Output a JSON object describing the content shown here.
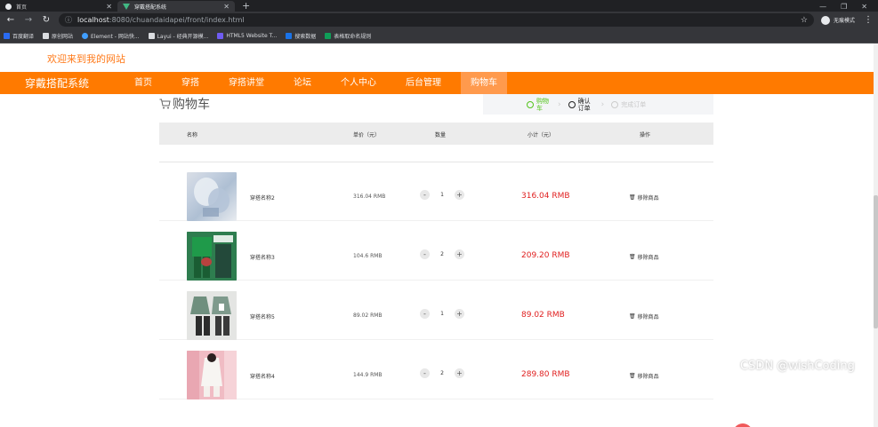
{
  "browser": {
    "tabs": [
      {
        "title": "首页",
        "icon": "globe-icon"
      },
      {
        "title": "穿戴搭配系统",
        "icon": "vue-icon"
      }
    ],
    "url_host": "localhost",
    "url_path": ":8080/chuandaidapei/front/index.html",
    "profile_label": "无痕模式",
    "bookmarks": [
      "百度翻译",
      "原创网站",
      "Element - 网站快...",
      "Layui - 经典开源模...",
      "HTML5 Website T...",
      "搜索数据",
      "表格取命名规则"
    ]
  },
  "header": {
    "welcome": "欢迎来到我的网站",
    "brand": "穿戴搭配系统",
    "nav": [
      "首页",
      "穿搭",
      "穿搭讲堂",
      "论坛",
      "个人中心",
      "后台管理",
      "购物车"
    ],
    "active_nav": "购物车"
  },
  "cart": {
    "title": "购物车",
    "steps": [
      {
        "label": "购物车",
        "state": "done"
      },
      {
        "label": "确认订单",
        "state": "current"
      },
      {
        "label": "完成订单",
        "state": "todo"
      }
    ],
    "columns": [
      "名称",
      "单价（元）",
      "数量",
      "小计（元）",
      "操作"
    ],
    "remove_label": "移除商品",
    "items": [
      {
        "name": "穿搭名称2",
        "price": "316.04 RMB",
        "qty": "1",
        "subtotal": "316.04 RMB"
      },
      {
        "name": "穿搭名称3",
        "price": "104.6 RMB",
        "qty": "2",
        "subtotal": "209.20 RMB"
      },
      {
        "name": "穿搭名称5",
        "price": "89.02 RMB",
        "qty": "1",
        "subtotal": "89.02 RMB"
      },
      {
        "name": "穿搭名称4",
        "price": "144.9 RMB",
        "qty": "2",
        "subtotal": "289.80 RMB"
      }
    ]
  },
  "watermark": "CSDN @wishCoding",
  "colors": {
    "accent": "#ff7a00",
    "price_red": "#e02020",
    "step_done": "#52c41a"
  }
}
